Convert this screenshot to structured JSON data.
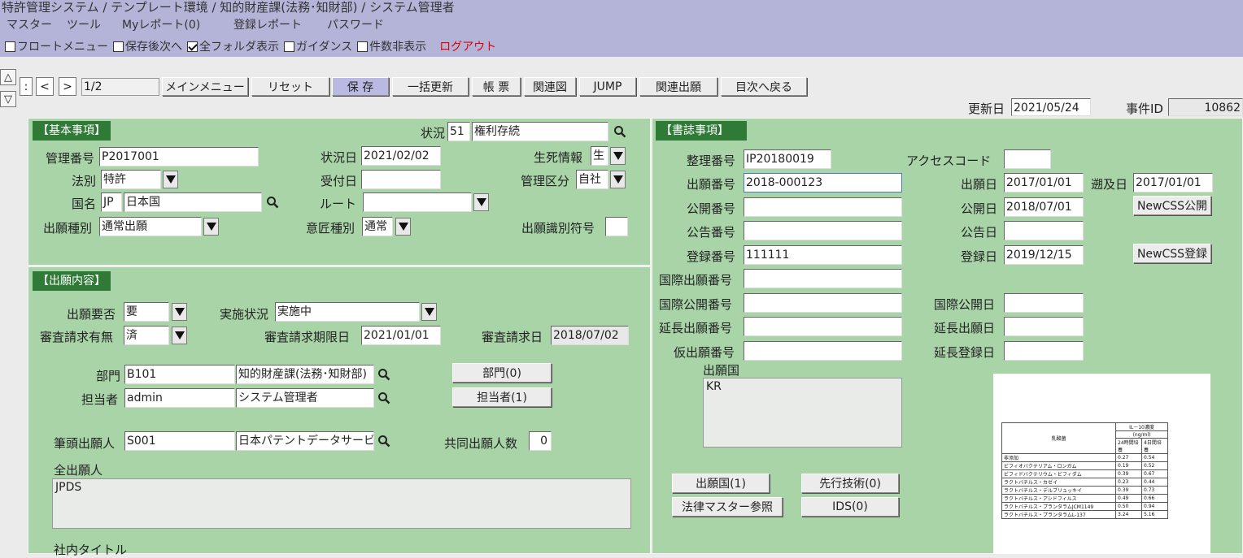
{
  "header": {
    "title": "特許管理システム / テンプレート環境 / 知的財産課(法務･知財部) / システム管理者",
    "menu": [
      "マスター",
      "ツール",
      "Myレポート(0)",
      "登録レポート",
      "パスワード"
    ],
    "options": [
      {
        "label": "フロートメニュー",
        "checked": false
      },
      {
        "label": "保存後次へ",
        "checked": false
      },
      {
        "label": "全フォルダ表示",
        "checked": true
      },
      {
        "label": "ガイダンス",
        "checked": false
      },
      {
        "label": "件数非表示",
        "checked": false
      }
    ],
    "logout": "ログアウト"
  },
  "toolbar": {
    "up_icon": "△",
    "down_icon": "▽",
    "first": ":",
    "prev": "<",
    "next": ">",
    "page": "1/2",
    "buttons": [
      "メインメニュー",
      "リセット",
      "保 存",
      "一括更新",
      "帳 票",
      "関連図",
      "JUMP",
      "関連出願",
      "目次へ戻る"
    ],
    "update_date_label": "更新日",
    "update_date": "2021/05/24",
    "case_id_label": "事件ID",
    "case_id": "10862"
  },
  "basic": {
    "header": "【基本事項】",
    "status_label": "状況",
    "status_code": "51",
    "status_text": "権利存続",
    "mgmt_no_label": "管理番号",
    "mgmt_no": "P2017001",
    "status_date_label": "状況日",
    "status_date": "2021/02/02",
    "life_label": "生死情報",
    "life_value": "生",
    "law_label": "法別",
    "law_value": "特許",
    "received_label": "受付日",
    "received_value": "",
    "mgmt_class_label": "管理区分",
    "mgmt_class_value": "自社",
    "country_label": "国名",
    "country_code": "JP",
    "country_name": "日本国",
    "route_label": "ルート",
    "route_value": "",
    "app_type_label": "出願種別",
    "app_type_value": "通常出願",
    "design_type_label": "意匠種別",
    "design_type_value": "通常",
    "app_id_label": "出願識別符号",
    "app_id_value": ""
  },
  "app": {
    "header": "【出願内容】",
    "need_label": "出願要否",
    "need_value": "要",
    "impl_label": "実施状況",
    "impl_value": "実施中",
    "exam_req_label": "審査請求有無",
    "exam_req_value": "済",
    "exam_deadline_label": "審査請求期限日",
    "exam_deadline_value": "2021/01/01",
    "exam_date_label": "審査請求日",
    "exam_date_value": "2018/07/02",
    "dept_label": "部門",
    "dept_code": "B101",
    "dept_name": "知的財産課(法務･知財部)",
    "dept_btn": "部門(0)",
    "person_label": "担当者",
    "person_code": "admin",
    "person_name": "システム管理者",
    "person_btn": "担当者(1)",
    "lead_label": "筆頭出願人",
    "lead_code": "S001",
    "lead_name": "日本パテントデータサービス",
    "joint_label": "共同出願人数",
    "joint_value": "0",
    "all_label": "全出願人",
    "all_value": "JPDS",
    "title_label": "社内タイトル"
  },
  "biblio": {
    "header": "【書誌事項】",
    "ref_no_label": "整理番号",
    "ref_no": "IP20180019",
    "access_label": "アクセスコード",
    "access_value": "",
    "app_no_label": "出願番号",
    "app_no": "2018-000123",
    "app_date_label": "出願日",
    "app_date": "2017/01/01",
    "retro_label": "遡及日",
    "retro_date": "2017/01/01",
    "pub_no_label": "公開番号",
    "pub_no": "",
    "pub_date_label": "公開日",
    "pub_date": "2018/07/01",
    "pub_btn": "NewCSS公開",
    "ann_no_label": "公告番号",
    "ann_no": "",
    "ann_date_label": "公告日",
    "ann_date": "",
    "reg_no_label": "登録番号",
    "reg_no": "111111",
    "reg_date_label": "登録日",
    "reg_date": "2019/12/15",
    "reg_btn": "NewCSS登録",
    "intl_app_label": "国際出願番号",
    "intl_app": "",
    "intl_pub_label": "国際公開番号",
    "intl_pub": "",
    "intl_pub_date_label": "国際公開日",
    "intl_pub_date": "",
    "ext_app_label": "延長出願番号",
    "ext_app": "",
    "ext_app_date_label": "延長出願日",
    "ext_app_date": "",
    "prov_label": "仮出願番号",
    "prov": "",
    "ext_reg_date_label": "延長登録日",
    "ext_reg_date": "",
    "countries_label": "出願国",
    "countries_value": "KR",
    "btn_countries": "出願国(1)",
    "btn_prior": "先行技術(0)",
    "btn_law": "法律マスター参照",
    "btn_ids": "IDS(0)"
  },
  "thumbnail_table": {
    "header_main": "乳酸菌",
    "header_top": "IL－10濃度",
    "header_unit": "(ng/ml)",
    "col1": "24時間培養",
    "col2": "4日間培養",
    "rows": [
      [
        "非添加",
        "0.27",
        "0.54"
      ],
      [
        "ビフィオバクテリアム・ロンガム",
        "0.19",
        "0.52"
      ],
      [
        "ビフィドバクテリウム・ビフィダム",
        "0.39",
        "0.67"
      ],
      [
        "ラクトバチルス・カゼイ",
        "0.23",
        "0.44"
      ],
      [
        "ラクトバチルス・デルブリュッキイ",
        "0.39",
        "0.73"
      ],
      [
        "ラクトバチルス・アシドフィルス",
        "0.49",
        "0.66"
      ],
      [
        "ラクトバチルス・プランタラムJCM1149",
        "0.50",
        "0.94"
      ],
      [
        "ラクトバチルス・プランタラムL-137",
        "3.24",
        "5.16"
      ]
    ]
  }
}
